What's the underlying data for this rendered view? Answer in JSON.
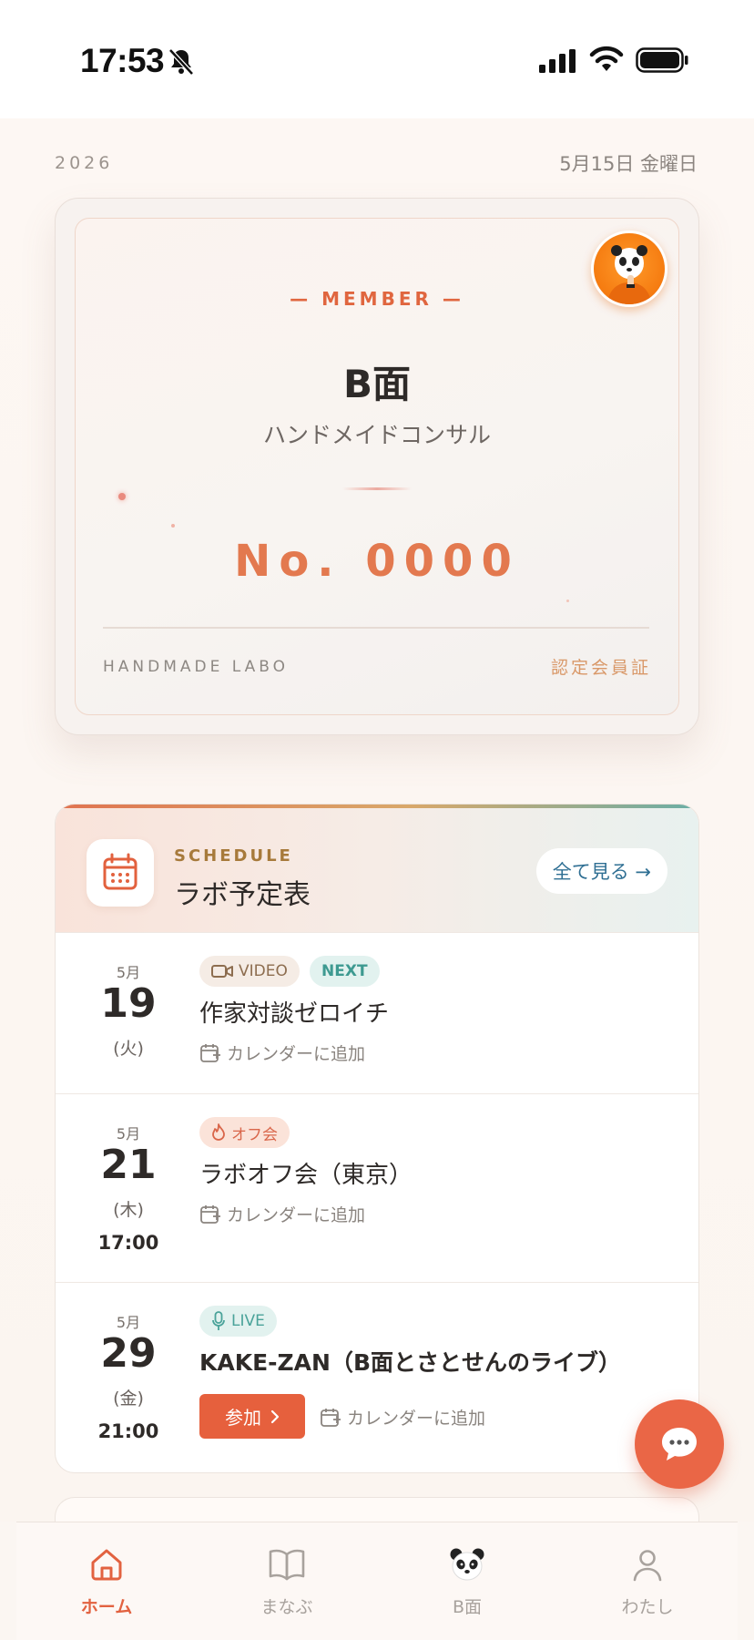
{
  "status_bar": {
    "time": "17:53"
  },
  "header": {
    "year": "2026",
    "date": "5月15日 金曜日"
  },
  "member_card": {
    "label": "— MEMBER —",
    "name": "B面",
    "role": "ハンドメイドコンサル",
    "number": "No. 0000",
    "footer_left": "HANDMADE LABO",
    "footer_right": "認定会員証"
  },
  "schedule": {
    "kicker": "SCHEDULE",
    "title": "ラボ予定表",
    "see_all": "全て見る →",
    "events": [
      {
        "month": "5月",
        "day": "19",
        "weekday": "(火)",
        "time": "",
        "tags": [
          {
            "label": "VIDEO",
            "icon": "video-icon"
          },
          {
            "label": "NEXT",
            "icon": ""
          }
        ],
        "title": "作家対談ゼロイチ",
        "add_calendar": "カレンダーに追加"
      },
      {
        "month": "5月",
        "day": "21",
        "weekday": "(木)",
        "time": "17:00",
        "tags": [
          {
            "label": "オフ会",
            "icon": "flame-icon"
          }
        ],
        "title": "ラボオフ会（東京）",
        "add_calendar": "カレンダーに追加"
      },
      {
        "month": "5月",
        "day": "29",
        "weekday": "(金)",
        "time": "21:00",
        "tags": [
          {
            "label": "LIVE",
            "icon": "mic-icon"
          }
        ],
        "title": "KAKE-ZAN（B面とさとせんのライブ）",
        "join": "参加",
        "add_calendar": "カレンダーに追加"
      }
    ]
  },
  "tabbar": {
    "items": [
      {
        "label": "ホーム",
        "icon": "home-icon",
        "active": true
      },
      {
        "label": "まなぶ",
        "icon": "book-icon",
        "active": false
      },
      {
        "label": "B面",
        "icon": "panda-icon",
        "active": false
      },
      {
        "label": "わたし",
        "icon": "person-icon",
        "active": false
      }
    ]
  },
  "colors": {
    "accent": "#e6603d",
    "teal": "#4aa39a",
    "link": "#2f6f93"
  }
}
